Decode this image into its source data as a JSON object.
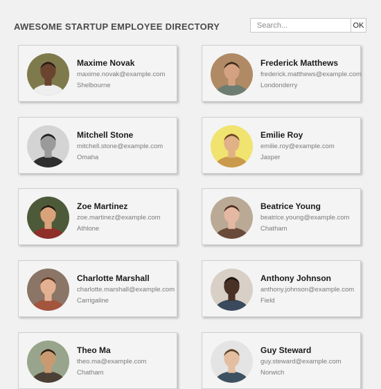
{
  "header": {
    "title": "Awesome Startup Employee Directory",
    "search_placeholder": "Search...",
    "search_button": "OK"
  },
  "employees": [
    {
      "name": "Maxime Novak",
      "email": "maxime.novak@example.com",
      "city": "Shelbourne",
      "bg": "#7f7a4c",
      "skin": "#6b4430",
      "hair": "#2a1c14",
      "shirt": "#eeeeee"
    },
    {
      "name": "Frederick Matthews",
      "email": "frederick.matthews@example.com",
      "city": "Londonderry",
      "bg": "#b08a64",
      "skin": "#d4a282",
      "hair": "#3a2a1d",
      "shirt": "#6d7d72"
    },
    {
      "name": "Mitchell Stone",
      "email": "mitchell.stone@example.com",
      "city": "Omaha",
      "bg": "#d4d4d4",
      "skin": "#9a9a9a",
      "hair": "#1e1e1e",
      "shirt": "#2e2e2e"
    },
    {
      "name": "Emilie Roy",
      "email": "emilie.roy@example.com",
      "city": "Jasper",
      "bg": "#f0e370",
      "skin": "#e1b187",
      "hair": "#6b4620",
      "shirt": "#c99a4c"
    },
    {
      "name": "Zoe Martinez",
      "email": "zoe.martinez@example.com",
      "city": "Athlone",
      "bg": "#4d5a3a",
      "skin": "#d8a27a",
      "hair": "#1d140f",
      "shirt": "#8f2f2a"
    },
    {
      "name": "Beatrice Young",
      "email": "beatrice.young@example.com",
      "city": "Chatham",
      "bg": "#b9a995",
      "skin": "#e4b8a2",
      "hair": "#4a2a1c",
      "shirt": "#6a4a3a"
    },
    {
      "name": "Charlotte Marshall",
      "email": "charlotte.marshall@example.com",
      "city": "Carrigaline",
      "bg": "#8a7566",
      "skin": "#e3b092",
      "hair": "#5c3320",
      "shirt": "#a3553d"
    },
    {
      "name": "Anthony Johnson",
      "email": "anthony.johnson@example.com",
      "city": "Field",
      "bg": "#d8d0c6",
      "skin": "#4a3126",
      "hair": "#1c1410",
      "shirt": "#3a4a5c"
    },
    {
      "name": "Theo Ma",
      "email": "theo.ma@example.com",
      "city": "Chatham",
      "bg": "#98a58c",
      "skin": "#c99a72",
      "hair": "#2a1d14",
      "shirt": "#4a4035"
    },
    {
      "name": "Guy Steward",
      "email": "guy.steward@example.com",
      "city": "Norwich",
      "bg": "#e4e4e4",
      "skin": "#e3bea0",
      "hair": "#5a3e25",
      "shirt": "#3e5160"
    }
  ]
}
